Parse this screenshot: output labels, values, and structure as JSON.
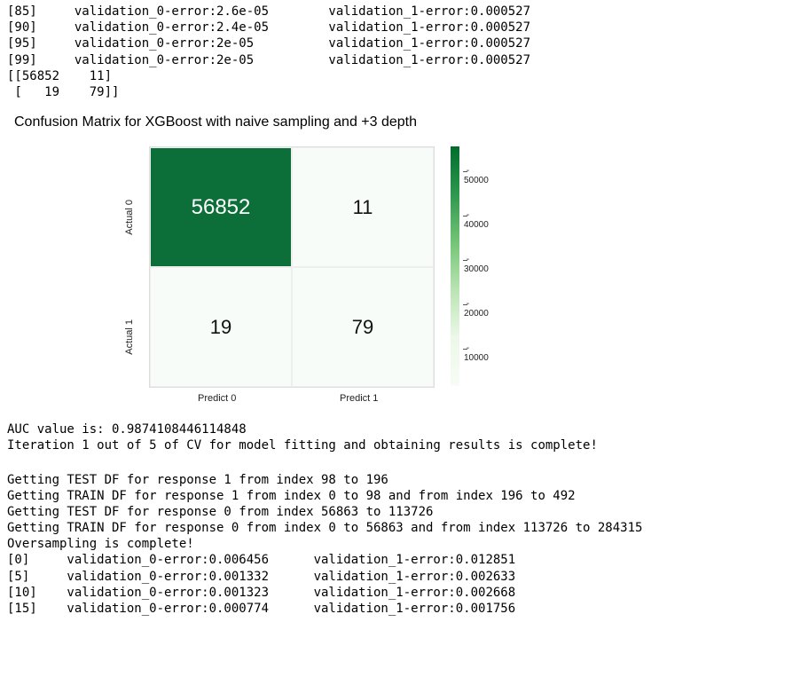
{
  "top_log": "[85]     validation_0-error:2.6e-05        validation_1-error:0.000527\n[90]     validation_0-error:2.4e-05        validation_1-error:0.000527\n[95]     validation_0-error:2e-05          validation_1-error:0.000527\n[99]     validation_0-error:2e-05          validation_1-error:0.000527\n[[56852    11]\n [   19    79]]",
  "chart_title": "Confusion Matrix for XGBoost with naive sampling and +3 depth",
  "chart_data": {
    "type": "heatmap",
    "title": "Confusion Matrix for XGBoost with naive sampling and +3 depth",
    "x_categories": [
      "Predict 0",
      "Predict 1"
    ],
    "y_categories": [
      "Actual 0",
      "Actual 1"
    ],
    "cells": [
      [
        56852,
        11
      ],
      [
        19,
        79
      ]
    ],
    "colorbar_ticks": [
      50000,
      40000,
      30000,
      20000,
      10000
    ],
    "colorbar_range": [
      0,
      56852
    ]
  },
  "cm": {
    "c00": "56852",
    "c01": "11",
    "c10": "19",
    "c11": "79",
    "yl0": "Actual 0",
    "yl1": "Actual 1",
    "xl0": "Predict 0",
    "xl1": "Predict 1"
  },
  "cbar": {
    "t50": "50000",
    "t40": "40000",
    "t30": "30000",
    "t20": "20000",
    "t10": "10000"
  },
  "mid_log": "AUC value is: 0.9874108446114848\nIteration 1 out of 5 of CV for model fitting and obtaining results is complete!",
  "bottom_log": "Getting TEST DF for response 1 from index 98 to 196\nGetting TRAIN DF for response 1 from index 0 to 98 and from index 196 to 492\nGetting TEST DF for response 0 from index 56863 to 113726\nGetting TRAIN DF for response 0 from index 0 to 56863 and from index 113726 to 284315\nOversampling is complete!\n[0]     validation_0-error:0.006456      validation_1-error:0.012851\n[5]     validation_0-error:0.001332      validation_1-error:0.002633\n[10]    validation_0-error:0.001323      validation_1-error:0.002668\n[15]    validation_0-error:0.000774      validation_1-error:0.001756"
}
